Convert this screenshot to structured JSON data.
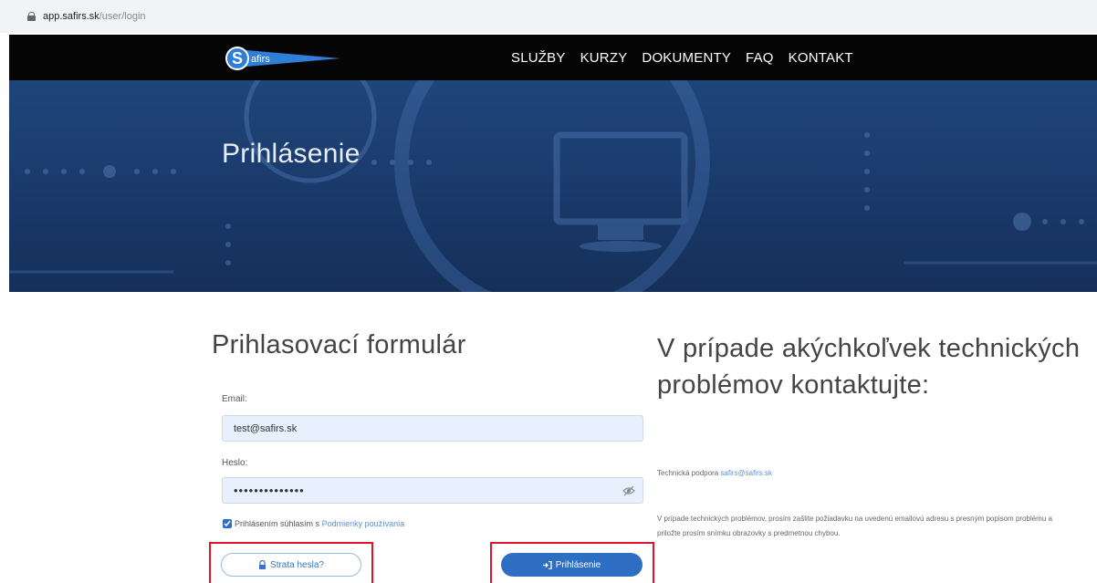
{
  "browser": {
    "url_host": "app.safirs.sk",
    "url_path": "/user/login"
  },
  "navbar": {
    "logo_text": "afirs",
    "items": [
      "SLUŽBY",
      "KURZY",
      "DOKUMENTY",
      "FAQ",
      "KONTAKT"
    ]
  },
  "hero": {
    "title": "Prihlásenie"
  },
  "form": {
    "title": "Prihlasovací formulár",
    "email_label": "Email:",
    "email_value": "test@safirs.sk",
    "password_label": "Heslo:",
    "password_value": "••••••••••••••",
    "terms_prefix": "Prihlásením súhlasím s ",
    "terms_link": "Podmienky používania",
    "lost_password_button": "Strata hesla?",
    "login_button": "Prihlásenie"
  },
  "support": {
    "title": "V prípade akýchkoľvek technických problémov kontaktujte:",
    "tech_label": "Technická podpora ",
    "tech_email": "safirs@safirs.sk",
    "note": "V prípade technických problémov, prosím zašlite požiadavku na uvedenú emailovú adresu s presným popisom problému a priložte prosím snímku obrazovky s predmetnou chybou."
  },
  "colors": {
    "brand_blue": "#2e6fc4",
    "highlight_red": "#e0142c",
    "navbar": "#050505"
  }
}
